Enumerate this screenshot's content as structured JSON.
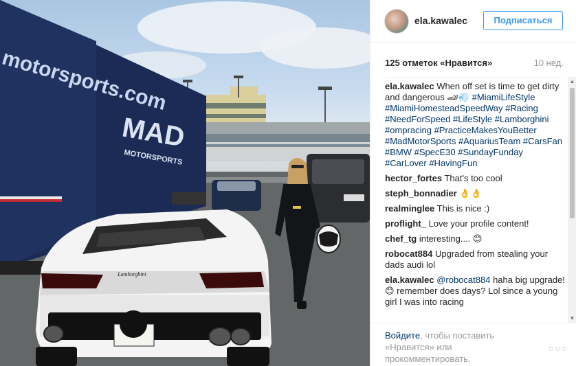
{
  "header": {
    "username": "ela.kawalec",
    "follow_label": "Подписаться"
  },
  "stats": {
    "likes": "125 отметок «Нравится»",
    "time": "10 нед."
  },
  "caption": {
    "user": "ela.kawalec",
    "text": "When off set is time to get dirty and dangerous 🏎💨",
    "hashtags": [
      "#MiamiLifeStyle",
      "#MiamiHomesteadSpeedWay",
      "#Racing",
      "#NeedForSpeed",
      "#LifeStyle",
      "#Lamborghini",
      "#ompracing",
      "#PracticeMakesYouBetter",
      "#MadMotorSports",
      "#AquariusTeam",
      "#CarsFan",
      "#BMW",
      "#SpecE30",
      "#SundayFunday",
      "#CarLover",
      "#HavingFun"
    ]
  },
  "comments": [
    {
      "user": "hector_fortes",
      "text": "That's too cool"
    },
    {
      "user": "steph_bonnadier",
      "text": "👌👌"
    },
    {
      "user": "realminglee",
      "text": "This is nice :)"
    },
    {
      "user": "proflight_",
      "text": "Love your profile content!"
    },
    {
      "user": "chef_tg",
      "text": "interesting.... 😊"
    },
    {
      "user": "robocat884",
      "text": "Upgraded from stealing your dads audi lol"
    },
    {
      "user": "ela.kawalec",
      "mention": "@robocat884",
      "text": "haha big upgrade! 😊 remember does days? Lol since a young girl I was into racing"
    }
  ],
  "footer": {
    "login_link": "Войдите",
    "login_rest": ", чтобы поставить «Нравится» или прокомментировать.",
    "more_icon": "ellipsis-icon"
  },
  "photo": {
    "trailer_text": "motorsports.com",
    "trailer_logo": "MAD",
    "trailer_logo_sub": "MOTORSPORTS",
    "car_badge": "Lamborghini"
  }
}
